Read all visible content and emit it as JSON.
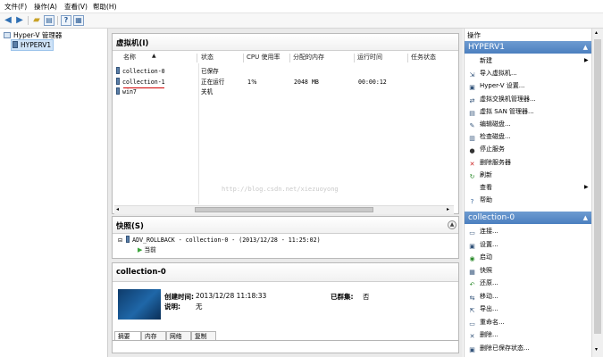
{
  "menu": [
    "文件(F)",
    "操作(A)",
    "查看(V)",
    "帮助(H)"
  ],
  "toolbar_icons": [
    "back-arrow-icon",
    "forward-arrow-icon",
    "folder-up-icon",
    "show-hide-tree-icon",
    "help-icon",
    "properties-icon"
  ],
  "tree": {
    "root": "Hyper-V 管理器",
    "server": "HYPERV1"
  },
  "vms_panel": {
    "title": "虚拟机(I)",
    "columns": [
      "名称",
      "状态",
      "CPU 使用率",
      "分配的内存",
      "运行时间",
      "任务状态"
    ],
    "rows": [
      {
        "name": "collection-0",
        "state": "已保存",
        "cpu": "",
        "memory": "",
        "uptime": "",
        "task": ""
      },
      {
        "name": "collection-1",
        "state": "正在运行",
        "cpu": "1%",
        "memory": "2048 MB",
        "uptime": "00:00:12",
        "task": ""
      },
      {
        "name": "win7",
        "state": "关机",
        "cpu": "",
        "memory": "",
        "uptime": "",
        "task": ""
      }
    ],
    "watermark": "http://blog.csdn.net/xiezuoyong"
  },
  "snapshots_panel": {
    "title": "快照(S)",
    "snapshot": "ADV_ROLLBACK - collection-0 - (2013/12/28 - 11:25:02)",
    "current": "当前"
  },
  "details_panel": {
    "title": "collection-0",
    "created_label": "创建时间:",
    "created_value": "2013/12/28 11:18:33",
    "notes_label": "说明:",
    "notes_value": "无",
    "clustered_label": "已群集:",
    "clustered_value": "否",
    "tabs": [
      "摘要",
      "内存",
      "网络",
      "复制"
    ]
  },
  "actions": {
    "title": "操作",
    "server_section": "HYPERV1",
    "server_items": [
      {
        "label": "新建",
        "icon": "new-icon",
        "submenu": true
      },
      {
        "label": "导入虚拟机...",
        "icon": "import-vm-icon",
        "submenu": false
      },
      {
        "label": "Hyper-V 设置...",
        "icon": "settings-icon",
        "submenu": false
      },
      {
        "label": "虚拟交换机管理器...",
        "icon": "virtual-switch-icon",
        "submenu": false
      },
      {
        "label": "虚拟 SAN 管理器...",
        "icon": "virtual-san-icon",
        "submenu": false
      },
      {
        "label": "编辑磁盘...",
        "icon": "edit-disk-icon",
        "submenu": false
      },
      {
        "label": "检查磁盘...",
        "icon": "inspect-disk-icon",
        "submenu": false
      },
      {
        "label": "停止服务",
        "icon": "stop-service-icon",
        "submenu": false
      },
      {
        "label": "删除服务器",
        "icon": "remove-server-icon",
        "submenu": false
      },
      {
        "label": "刷新",
        "icon": "refresh-icon",
        "submenu": false
      },
      {
        "label": "查看",
        "icon": "",
        "submenu": true
      },
      {
        "label": "帮助",
        "icon": "help-icon",
        "submenu": false
      }
    ],
    "vm_section": "collection-0",
    "vm_items": [
      {
        "label": "连接...",
        "icon": "connect-icon"
      },
      {
        "label": "设置...",
        "icon": "vm-settings-icon"
      },
      {
        "label": "启动",
        "icon": "start-icon"
      },
      {
        "label": "快照",
        "icon": "snapshot-icon"
      },
      {
        "label": "还原...",
        "icon": "revert-icon"
      },
      {
        "label": "移动...",
        "icon": "move-icon"
      },
      {
        "label": "导出...",
        "icon": "export-icon"
      },
      {
        "label": "重命名...",
        "icon": "rename-icon"
      },
      {
        "label": "删除...",
        "icon": "delete-icon"
      },
      {
        "label": "删除已保存状态...",
        "icon": "delete-saved-state-icon"
      }
    ]
  },
  "colors": {
    "selection": "#cfe3f7",
    "section_header": "#4b7fbf",
    "underline": "#d10000"
  }
}
